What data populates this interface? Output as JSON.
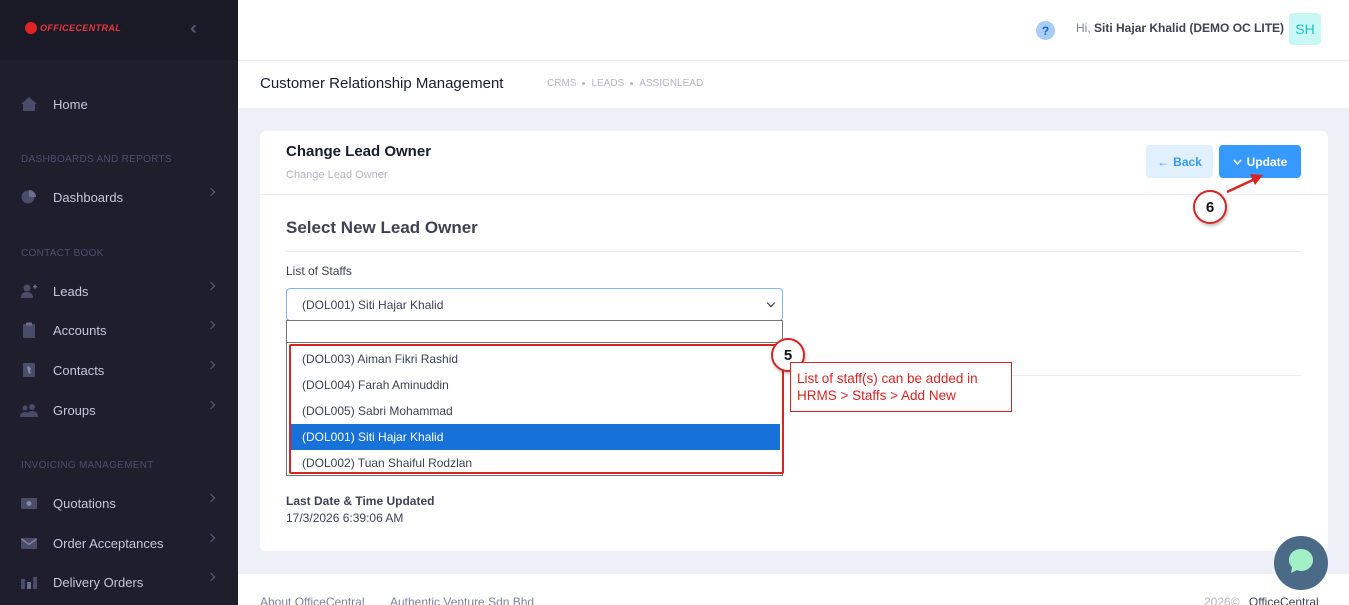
{
  "brand": {
    "logo_text": "OFFICECENTRAL"
  },
  "sidebar": {
    "items": [
      {
        "label": "Home",
        "icon": "home-icon"
      },
      {
        "label": "Dashboards",
        "icon": "pie-chart-icon"
      },
      {
        "label": "Leads",
        "icon": "user-add-icon"
      },
      {
        "label": "Accounts",
        "icon": "clipboard-icon"
      },
      {
        "label": "Contacts",
        "icon": "address-book-icon"
      },
      {
        "label": "Groups",
        "icon": "group-icon"
      },
      {
        "label": "Quotations",
        "icon": "money-icon"
      },
      {
        "label": "Order Acceptances",
        "icon": "envelope-icon"
      },
      {
        "label": "Delivery Orders",
        "icon": "truck-icon"
      }
    ],
    "sections": [
      "DASHBOARDS AND REPORTS",
      "CONTACT BOOK",
      "INVOICING MANAGEMENT"
    ]
  },
  "header": {
    "greeting_prefix": "Hi,",
    "user_name": "Siti Hajar Khalid (DEMO OC LITE)",
    "avatar_initials": "SH",
    "help_glyph": "?"
  },
  "subheader": {
    "title": "Customer Relationship Management",
    "breadcrumbs": [
      "CRMS",
      "LEADS",
      "ASSIGNLEAD"
    ]
  },
  "card": {
    "title": "Change Lead Owner",
    "subtitle": "Change Lead Owner",
    "back_label": "Back",
    "update_label": "Update",
    "section_title": "Select New Lead Owner",
    "field_label": "List of Staffs",
    "selected_value": "(DOL001) Siti Hajar Khalid",
    "last_updated_label": "Last Date & Time Updated",
    "last_updated_value": "17/3/2026 6:39:06 AM"
  },
  "dropdown": {
    "options": [
      {
        "label": "(DOL003) Aiman Fikri Rashid",
        "selected": false
      },
      {
        "label": "(DOL004) Farah Aminuddin",
        "selected": false
      },
      {
        "label": "(DOL005) Sabri Mohammad",
        "selected": false
      },
      {
        "label": "(DOL001) Siti Hajar Khalid",
        "selected": true
      },
      {
        "label": "(DOL002) Tuan Shaiful Rodzlan",
        "selected": false
      }
    ]
  },
  "annotations": {
    "step5": "5",
    "step6": "6",
    "note_line1": "List of staff(s) can be added in",
    "note_line2": "HRMS > Staffs > Add New"
  },
  "footer": {
    "link1": "About OfficeCentral",
    "link2": "Authentic Venture Sdn Bhd",
    "copyright": "2026©",
    "brand": "OfficeCentral"
  },
  "colors": {
    "primary": "#3699ff",
    "sidebar_bg": "#1e1e2d",
    "annotation_red": "#d92424",
    "selected_option": "#1672d8"
  }
}
